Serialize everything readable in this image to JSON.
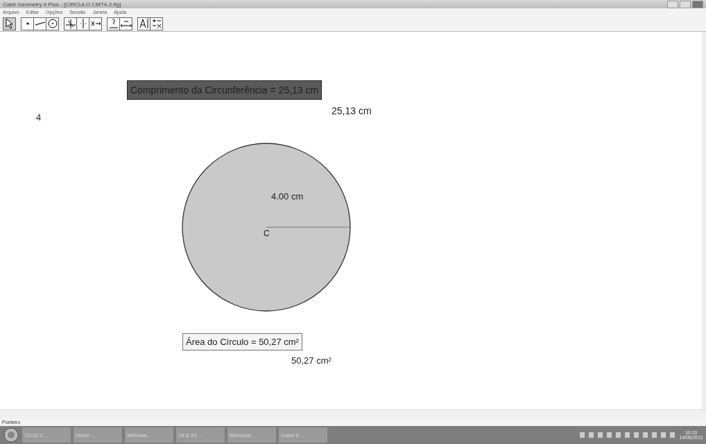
{
  "window": {
    "title": "Cabri Geometry II Plus - [CIRCULO CMT4-2.fig]"
  },
  "menu": [
    "Arquivo",
    "Editar",
    "Opções",
    "Sessão",
    "Janela",
    "Ajuda"
  ],
  "toolbar": [
    [
      {
        "kind": "pointer",
        "selected": true
      }
    ],
    [
      {
        "kind": "point",
        "selected": false
      },
      {
        "kind": "line",
        "selected": false
      },
      {
        "kind": "circle",
        "selected": false
      }
    ],
    [
      {
        "kind": "perpendicular",
        "selected": false
      },
      {
        "kind": "symmetry",
        "selected": false
      },
      {
        "kind": "transform",
        "selected": false
      }
    ],
    [
      {
        "kind": "query",
        "selected": false
      },
      {
        "kind": "measure",
        "selected": false
      }
    ],
    [
      {
        "kind": "text",
        "selected": false
      },
      {
        "kind": "calculator",
        "selected": false
      }
    ]
  ],
  "canvas": {
    "circumference_label": "Comprimento da Circunferência = 25,13 cm",
    "circumference_value": "25,13 cm",
    "number": "4",
    "radius_label": "4.00 cm",
    "center_label": "C",
    "area_label": "Área do Círculo = 50,27 cm²",
    "area_value": "50,27 cm²"
  },
  "status_bar": "Ponteiro",
  "taskbar": {
    "items": [
      "12/10 C...",
      "Orkut -...",
      "Window...",
      "24.8.10 ...",
      "Microsof...",
      "Cabri II ..."
    ],
    "time": "10:20",
    "date": "14/05/2011"
  }
}
